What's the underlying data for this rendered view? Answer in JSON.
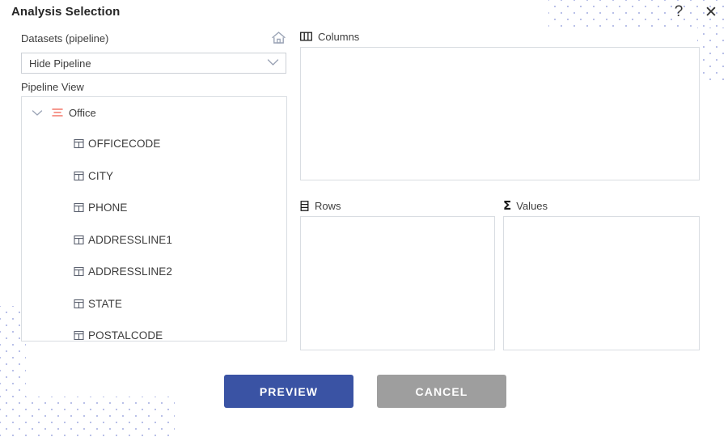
{
  "window": {
    "title": "Analysis Selection",
    "help_icon": "question-mark-help-icon",
    "close_icon": "close-x-icon"
  },
  "left_pane": {
    "datasets_label": "Datasets (pipeline)",
    "home_icon": "home-icon",
    "pipeline_select": {
      "value": "Hide Pipeline",
      "chevron_icon": "chevron-down-icon"
    },
    "pipeline_view_label": "Pipeline View",
    "tree": {
      "root": {
        "label": "Office",
        "expanded": true,
        "expand_icon": "chevron-down-icon",
        "node_icon": "table-list-icon",
        "node_icon_color": "#f4786b"
      },
      "children": [
        {
          "label": "OFFICECODE",
          "icon": "column-field-icon"
        },
        {
          "label": "CITY",
          "icon": "column-field-icon"
        },
        {
          "label": "PHONE",
          "icon": "column-field-icon"
        },
        {
          "label": "ADDRESSLINE1",
          "icon": "column-field-icon"
        },
        {
          "label": "ADDRESSLINE2",
          "icon": "column-field-icon"
        },
        {
          "label": "STATE",
          "icon": "column-field-icon"
        },
        {
          "label": "POSTALCODE",
          "icon": "column-field-icon"
        }
      ]
    }
  },
  "right_pane": {
    "columns": {
      "label": "Columns",
      "icon": "columns-icon",
      "items": []
    },
    "rows": {
      "label": "Rows",
      "icon": "rows-icon",
      "items": []
    },
    "values": {
      "label": "Values",
      "icon": "sigma-icon",
      "glyph": "Σ",
      "items": []
    }
  },
  "footer": {
    "preview_label": "PREVIEW",
    "cancel_label": "CANCEL"
  },
  "colors": {
    "primary_button": "#3a53a4",
    "secondary_button": "#9e9e9e",
    "tree_root_icon": "#f4786b",
    "dot_pattern": "#b9c0e8",
    "border": "#d9dde2",
    "text": "#3c3c3c"
  }
}
